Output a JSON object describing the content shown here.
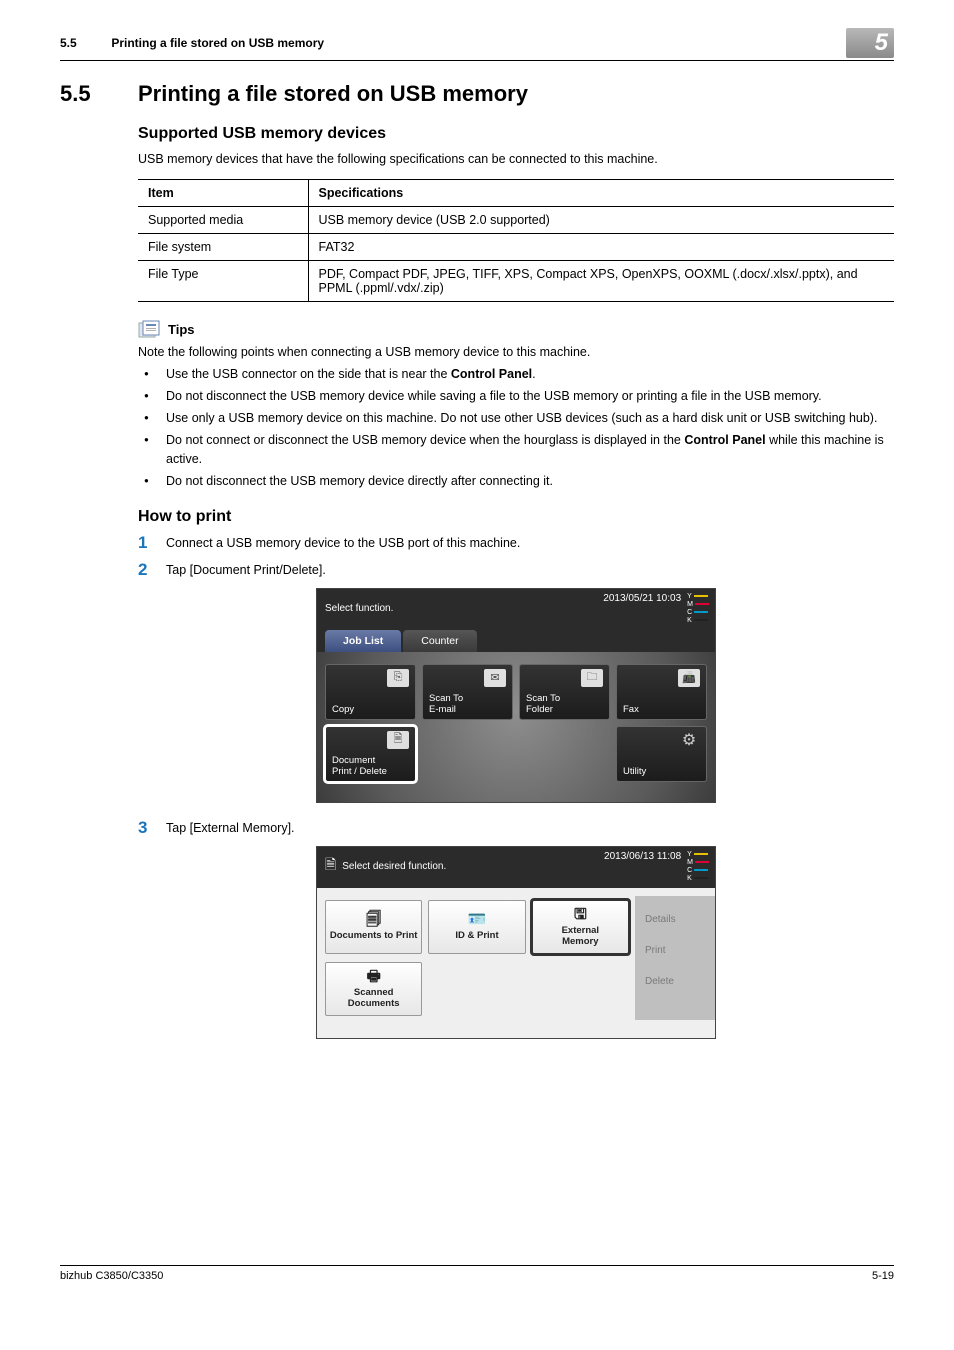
{
  "running_header": {
    "section_number": "5.5",
    "section_title": "Printing a file stored on USB memory",
    "chapter_number": "5"
  },
  "heading": {
    "number": "5.5",
    "title": "Printing a file stored on USB memory"
  },
  "subheads": {
    "supported": "Supported USB memory devices",
    "howto": "How to print"
  },
  "intro_para": "USB memory devices that have the following specifications can be connected to this machine.",
  "spec_table": {
    "headers": {
      "item": "Item",
      "spec": "Specifications"
    },
    "rows": [
      {
        "item": "Supported media",
        "spec": "USB memory device (USB 2.0 supported)"
      },
      {
        "item": "File system",
        "spec": "FAT32"
      },
      {
        "item": "File Type",
        "spec": "PDF, Compact PDF, JPEG, TIFF, XPS, Compact XPS, OpenXPS, OOXML (.docx/.xlsx/.pptx), and PPML (.ppml/.vdx/.zip)"
      }
    ]
  },
  "tips": {
    "label": "Tips",
    "intro": "Note the following points when connecting a USB memory device to this machine.",
    "items": [
      {
        "pre": "Use the USB connector on the side that is near the ",
        "bold": "Control Panel",
        "post": "."
      },
      {
        "pre": "Do not disconnect the USB memory device while saving a file to the USB memory or printing a file in the USB memory.",
        "bold": "",
        "post": ""
      },
      {
        "pre": "Use only a USB memory device on this machine. Do not use other USB devices (such as a hard disk unit or USB switching hub).",
        "bold": "",
        "post": ""
      },
      {
        "pre": "Do not connect or disconnect the USB memory device when the hourglass is displayed in the ",
        "bold": "Control Panel",
        "post": " while this machine is active."
      },
      {
        "pre": "Do not disconnect the USB memory device directly after connecting it.",
        "bold": "",
        "post": ""
      }
    ]
  },
  "steps": {
    "s1": {
      "num": "1",
      "text": "Connect a USB memory device to the USB port of this machine."
    },
    "s2": {
      "num": "2",
      "text": "Tap [Document Print/Delete]."
    },
    "s3": {
      "num": "3",
      "text": "Tap [External Memory]."
    }
  },
  "screen1": {
    "title": "Select function.",
    "timestamp": "2013/05/21 10:03",
    "tabs": {
      "joblist": "Job List",
      "counter": "Counter"
    },
    "tiles": {
      "copy": "Copy",
      "scan_email": "Scan To\nE-mail",
      "scan_folder": "Scan To\nFolder",
      "fax": "Fax",
      "doc_print": "Document\nPrint / Delete",
      "utility": "Utility"
    },
    "toner": {
      "y": "Y",
      "m": "M",
      "c": "C",
      "k": "K"
    }
  },
  "screen2": {
    "title": "Select desired function.",
    "timestamp": "2013/06/13 11:08",
    "tiles": {
      "docs_to_print": "Documents to Print",
      "id_print": "ID & Print",
      "external_memory": "External\nMemory",
      "scanned_docs": "Scanned\nDocuments"
    },
    "side": {
      "details": "Details",
      "print": "Print",
      "delete": "Delete"
    },
    "toner": {
      "y": "Y",
      "m": "M",
      "c": "C",
      "k": "K"
    }
  },
  "footer": {
    "model": "bizhub C3850/C3350",
    "page": "5-19"
  }
}
